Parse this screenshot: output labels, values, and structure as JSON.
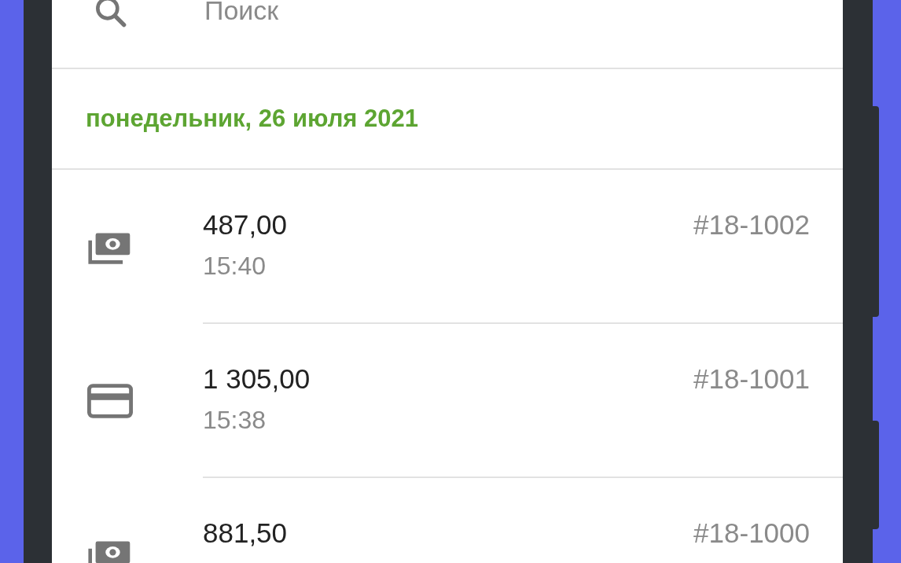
{
  "search": {
    "placeholder": "Поиск"
  },
  "date_header": "понедельник, 26 июля 2021",
  "transactions": [
    {
      "kind": "cash",
      "amount": "487,00",
      "time": "15:40",
      "order": "#18-1002"
    },
    {
      "kind": "card",
      "amount": "1 305,00",
      "time": "15:38",
      "order": "#18-1001"
    },
    {
      "kind": "cash",
      "amount": "881,50",
      "order": "#18-1000"
    }
  ]
}
